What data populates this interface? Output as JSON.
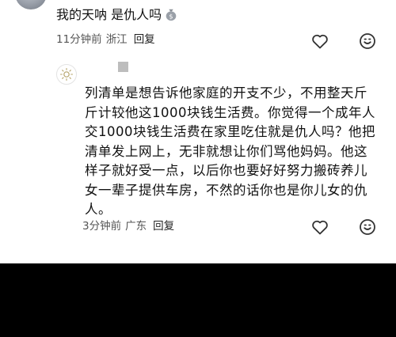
{
  "comment_1": {
    "text": "我的天呐 是仇人吗",
    "emoji": "money-bag-emoji",
    "time": "11分钟前",
    "location": "浙江",
    "reply_label": "回复"
  },
  "comment_2": {
    "text": "列清单是想告诉他家庭的开支不少，不用整天斤斤计较他这1000块钱生活费。你觉得一个成年人交1000块钱生活费在家里吃住就是仇人吗？他把清单发上网上，无非就想让你们骂他妈妈。他这样子就好受一点，以后你也要好好努力搬砖养儿女一辈子提供车房，不然的话你也是你儿女的仇人。",
    "time": "3分钟前",
    "location": "广东",
    "reply_label": "回复"
  },
  "icons": {
    "like": "heart-outline-icon",
    "emoji": "smiley-face-icon"
  },
  "colors": {
    "text": "#111111",
    "meta": "#555555",
    "icon": "#333333",
    "background": "#ffffff",
    "overlay": "#000000"
  }
}
